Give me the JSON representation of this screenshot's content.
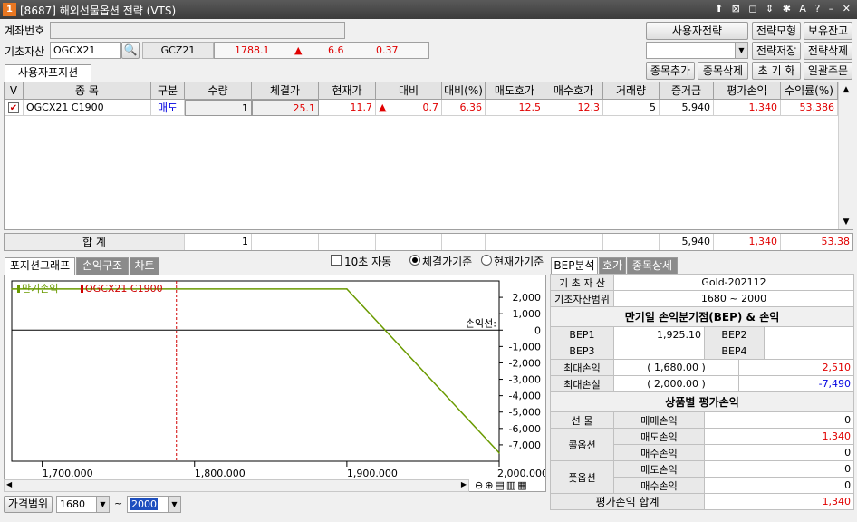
{
  "window": {
    "title": "[8687] 해외선물옵션 전략 (VTS)",
    "icon": "1",
    "controls": "⬆ ⊠ ◻ ⇕ ✱ A ?  –  ✕"
  },
  "account": {
    "label": "계좌번호",
    "value": ""
  },
  "base_asset": {
    "label": "기초자산",
    "code": "OGCX21",
    "underlying": "GCZ21",
    "price": "1788.1",
    "change": "6.6",
    "rate": "0.37"
  },
  "user_strategy": {
    "button": "사용자전략",
    "select_value": "",
    "buttons": {
      "model": "전략모형",
      "holding": "보유잔고",
      "save": "전략저장",
      "delete": "전략삭제",
      "add_item": "종목추가",
      "del_item": "종목삭제",
      "reset": "초 기 화",
      "bulk_order": "일괄주문"
    }
  },
  "position_tab": "사용자포지션",
  "grid": {
    "columns": [
      "V",
      "종 목",
      "구분",
      "수량",
      "체결가",
      "현재가",
      "대비",
      "대비(%)",
      "매도호가",
      "매수호가",
      "거래량",
      "증거금",
      "평가손익",
      "수익률(%)"
    ],
    "rows": [
      {
        "check": "✔",
        "name": "OGCX21 C1900",
        "side": "매도",
        "qty": "1",
        "fill": "25.1",
        "cur": "11.7",
        "chg": "0.7",
        "chg_pct": "6.36",
        "ask": "12.5",
        "bid": "12.3",
        "vol": "5",
        "margin": "5,940",
        "pnl": "1,340",
        "ret": "53.386"
      }
    ],
    "total": {
      "label": "합    계",
      "qty": "1",
      "margin": "5,940",
      "pnl": "1,340",
      "ret": "53.38"
    }
  },
  "bottom_tabs": {
    "graph": "포지션그래프",
    "pnl": "손익구조",
    "chart": "차트"
  },
  "options": {
    "auto": "10초 자동",
    "fill_basis": "체결가기준",
    "cur_basis": "현재가기준"
  },
  "chart_data": {
    "type": "line",
    "series": [
      {
        "name": "만기손익",
        "color": "#6a9a00",
        "points": [
          [
            1680,
            2510
          ],
          [
            1900,
            2510
          ],
          [
            2000,
            -7490
          ]
        ]
      }
    ],
    "marker": {
      "name": "OGCX21 C1900",
      "x": 1788.1,
      "color": "#d00000"
    },
    "xlim": [
      1680,
      2000
    ],
    "ylim": [
      -8000,
      3000
    ],
    "x_ticks": [
      1700,
      1800,
      1900,
      2000
    ],
    "x_tick_labels": [
      "1,700.000",
      "1,800.000",
      "1,900.000",
      "2,000.000"
    ],
    "y_ticks": [
      2000,
      1000,
      0,
      -1000,
      -2000,
      -3000,
      -4000,
      -5000,
      -6000,
      -7000
    ],
    "y_tick_labels": [
      "2,000",
      "1,000",
      "0",
      "-1,000",
      "-2,000",
      "-3,000",
      "-4,000",
      "-5,000",
      "-6,000",
      "-7,000"
    ],
    "zero_label": "손익선:"
  },
  "price_range": {
    "label": "가격범위",
    "low": "1680",
    "high": "2000",
    "sep": "~"
  },
  "bep_tabs": {
    "bep": "BEP분석",
    "quote": "호가",
    "detail": "종목상세"
  },
  "bep": {
    "base_label": "기 초 자 산",
    "base_value": "Gold-202112",
    "range_label": "기초자산범위",
    "range_value": "1680 ~ 2000",
    "section_title": "만기일 손익분기점(BEP) & 손익",
    "bep1_label": "BEP1",
    "bep1": "1,925.10",
    "bep2_label": "BEP2",
    "bep2": "",
    "bep3_label": "BEP3",
    "bep3": "",
    "bep4_label": "BEP4",
    "bep4": "",
    "max_profit_label": "최대손익",
    "max_profit_price": "(   1,680.00   )",
    "max_profit": "2,510",
    "max_loss_label": "최대손실",
    "max_loss_price": "(   2,000.00   )",
    "max_loss": "-7,490",
    "product_title": "상품별 평가손익",
    "futures": "선  물",
    "call": "콜옵션",
    "put": "풋옵션",
    "trade_pnl": "매매손익",
    "sell_pnl": "매도손익",
    "buy_pnl": "매수손익",
    "fut_trade": "0",
    "call_sell": "1,340",
    "call_buy": "0",
    "put_sell": "0",
    "put_buy": "0",
    "total_label": "평가손익 합계",
    "total": "1,340"
  }
}
